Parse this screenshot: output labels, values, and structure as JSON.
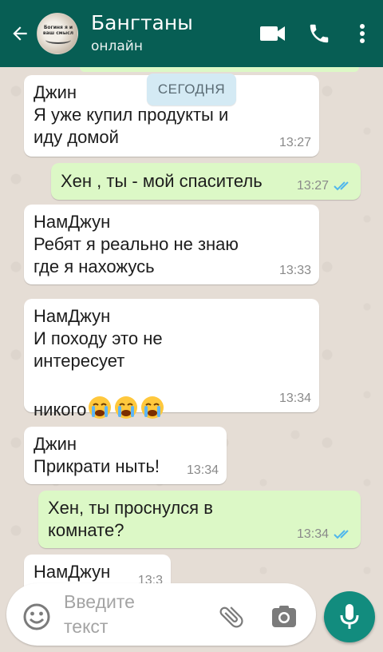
{
  "header": {
    "title": "Бангтаны",
    "status": "онлайн",
    "avatar_text": "Богиня я и ваш смысл",
    "colors": {
      "bar": "#075e54",
      "accent": "#128c7e"
    },
    "icons": [
      "back-arrow-icon",
      "video-call-icon",
      "phone-icon",
      "more-vert-icon"
    ]
  },
  "chat": {
    "date_label": "СЕГОДНЯ",
    "messages": [
      {
        "direction": "in",
        "sender": "Джин",
        "text": "Я уже купил продукты и\nиду домой",
        "time": "13:27"
      },
      {
        "direction": "out",
        "text": "Хен , ты - мой спаситель",
        "time": "13:27",
        "read": true
      },
      {
        "direction": "in",
        "sender": "НамДжун",
        "text": "Ребят я реально не знаю\nгде я нахожусь",
        "time": "13:33"
      },
      {
        "direction": "in",
        "sender": "НамДжун",
        "text": "И походу это не\nинтересует\n\nникого",
        "emoji": [
          "loudly-crying-face",
          "loudly-crying-face",
          "loudly-crying-face"
        ],
        "time": "13:34"
      },
      {
        "direction": "in",
        "sender": "Джин",
        "text": "Прикрати ныть!",
        "time": "13:34"
      },
      {
        "direction": "out",
        "text": "Хен, ты проснулся в\nкомнате?",
        "time": "13:34",
        "read": true
      },
      {
        "direction": "in",
        "sender": "НамДжун",
        "text": "",
        "time": "13:3",
        "partial": true
      }
    ]
  },
  "input": {
    "placeholder": "Введите\nтекст",
    "icons": [
      "emoji-icon",
      "attach-icon",
      "camera-icon",
      "mic-icon"
    ]
  }
}
